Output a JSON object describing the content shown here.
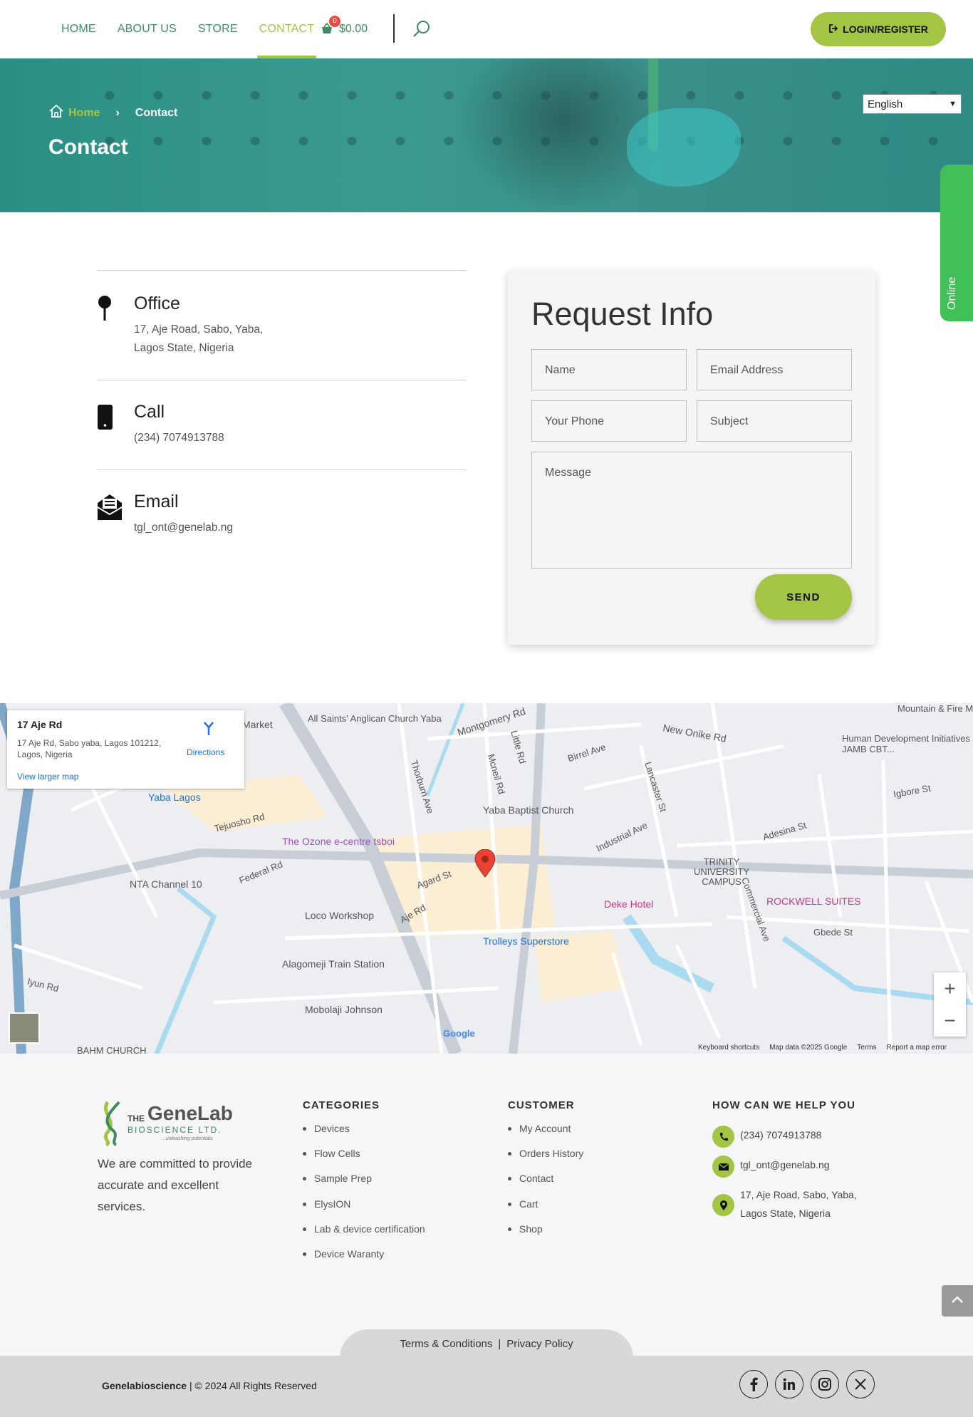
{
  "header": {
    "nav": [
      "HOME",
      "ABOUT US",
      "STORE",
      "CONTACT"
    ],
    "active_nav": "CONTACT",
    "cart_count": "0",
    "cart_total": "$0.00",
    "login_label": "LOGIN/REGISTER",
    "accent": "#a3c543",
    "nav_color": "#3f8a5f"
  },
  "hero": {
    "breadcrumb_home": "Home",
    "breadcrumb_current": "Contact",
    "title": "Contact",
    "language": "English"
  },
  "online_tab": "Online",
  "contact": {
    "office_title": "Office",
    "office_line1": "17, Aje Road, Sabo, Yaba,",
    "office_line2": "Lagos State, Nigeria",
    "call_title": "Call",
    "call_value": "(234) 7074913788",
    "email_title": "Email",
    "email_value": "tgl_ont@genelab.ng"
  },
  "form": {
    "title": "Request Info",
    "name_placeholder": "Name",
    "email_placeholder": "Email Address",
    "phone_placeholder": "Your Phone",
    "subject_placeholder": "Subject",
    "message_placeholder": "Message",
    "send_label": "SEND"
  },
  "map": {
    "card_title": "17 Aje Rd",
    "card_address": "17 Aje Rd, Sabo yaba, Lagos 101212, Lagos, Nigeria",
    "card_larger": "View larger map",
    "card_directions": "Directions",
    "zoom_in": "+",
    "zoom_out": "−",
    "footer": [
      "Keyboard shortcuts",
      "Map data ©2025 Google",
      "Terms",
      "Report a map error"
    ],
    "google_logo": "Google",
    "places": [
      "All Saints' Anglican Church Yaba",
      "Montgomery Rd",
      "New Onike Rd",
      "Human Development Initiatives JAMB CBT...",
      "Mountain & Fire Miracle Ministries",
      "Yaba Lagos",
      "Tejuosho Rd",
      "Birrel Ave",
      "Yaba Baptist Church",
      "The Ozone e-centre tsboi",
      "Industrial Ave",
      "TRINITY UNIVERSITY CAMPUS",
      "Igbore St",
      "Adesina St",
      "NTA Channel 10",
      "Federal Rd",
      "Agard St",
      "Aje Rd",
      "Deke Hotel",
      "ROCKWELL SUITES",
      "Loco Workshop",
      "Trolleys Superstore",
      "Gbede St",
      "Alagomeji Train Station",
      "Mobolaji Johnson",
      "Iyun Rd",
      "BAHM CHURCH",
      "Commercial Ave",
      "Lancaster St",
      "Thorburn Ave",
      "Mcneil Rd",
      "Little Rd",
      "Market"
    ]
  },
  "footer": {
    "logo_the": "THE",
    "logo_main": "GeneLab",
    "logo_sub": "BIOSCIENCE LTD.",
    "logo_tag": "...unleashing potentials",
    "tagline": "We are committed to provide accurate and excellent services.",
    "categories_title": "CATEGORIES",
    "categories": [
      "Devices",
      "Flow Cells",
      "Sample Prep",
      "ElysION",
      "Lab & device certification",
      "Device Waranty"
    ],
    "customer_title": "CUSTOMER",
    "customer": [
      "My Account",
      "Orders History",
      "Contact",
      "Cart",
      "Shop"
    ],
    "help_title": "HOW CAN WE HELP YOU",
    "help_phone": "(234) 7074913788",
    "help_email": "tgl_ont@genelab.ng",
    "help_address_1": "17, Aje Road, Sabo, Yaba,",
    "help_address_2": "Lagos State, Nigeria",
    "terms": "Terms & Conditions",
    "terms_sep": "|",
    "privacy": "Privacy Policy",
    "brand": "Genelabioscience",
    "copyright": " | © 2024 All Rights Reserved",
    "socials": [
      "facebook-icon",
      "linkedin-icon",
      "instagram-icon",
      "x-icon"
    ]
  }
}
